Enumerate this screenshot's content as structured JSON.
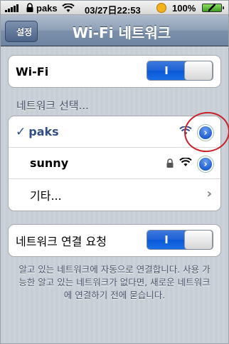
{
  "status_bar": {
    "carrier": "paks",
    "time": "03/27日22:53",
    "battery_percent": "100%",
    "signal_icon": "signal-bars-icon",
    "wifi_icon": "wifi-icon",
    "lock_icon": "lock-icon",
    "face_icon": "smiley-icon",
    "battery_icon": "battery-charging-icon"
  },
  "nav": {
    "back_label": "설정",
    "title": "Wi-Fi 네트워크"
  },
  "wifi_row": {
    "label": "Wi-Fi",
    "toggle_text": "I",
    "toggle_on": true
  },
  "networks": {
    "header": "네트워크 선택...",
    "items": [
      {
        "name": "paks",
        "selected": true,
        "secured": false,
        "check": "✓"
      },
      {
        "name": "sunny",
        "selected": false,
        "secured": true
      }
    ],
    "other_label": "기타..."
  },
  "ask_row": {
    "label": "네트워크 연결 요청",
    "toggle_text": "I",
    "toggle_on": true
  },
  "footer": {
    "text": "알고 있는 네트워크에 자동으로 연결합니다. 사용 가능한 알고 있는 네트워크가 없다면, 새로운 네트워크에 연결하기 전에 묻습니다."
  },
  "colors": {
    "accent_blue": "#1e62d6",
    "nav_bar": "#8d9fb6",
    "selected_text": "#324f85",
    "annotation_red": "#c8222a"
  }
}
